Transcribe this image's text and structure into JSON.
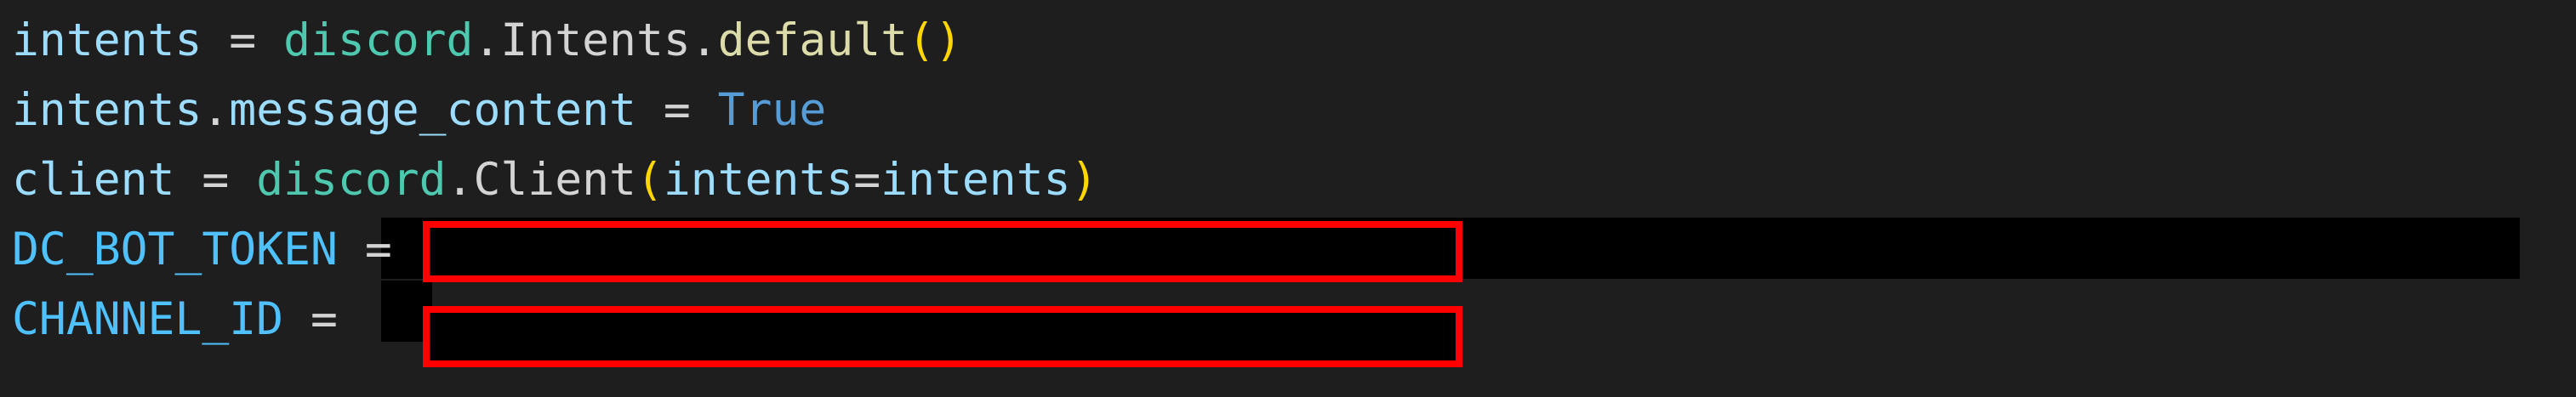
{
  "editor": {
    "lines": [
      {
        "tokens": [
          {
            "text": "intents",
            "kind": "var"
          },
          {
            "text": " = ",
            "kind": "plain"
          },
          {
            "text": "discord",
            "kind": "mod"
          },
          {
            "text": ".",
            "kind": "plain"
          },
          {
            "text": "Intents",
            "kind": "plain"
          },
          {
            "text": ".",
            "kind": "plain"
          },
          {
            "text": "default",
            "kind": "fn"
          },
          {
            "text": "()",
            "kind": "paren"
          }
        ]
      },
      {
        "tokens": [
          {
            "text": "intents",
            "kind": "var"
          },
          {
            "text": ".",
            "kind": "plain"
          },
          {
            "text": "message_content",
            "kind": "var"
          },
          {
            "text": " = ",
            "kind": "plain"
          },
          {
            "text": "True",
            "kind": "kw"
          }
        ]
      },
      {
        "tokens": [
          {
            "text": "client",
            "kind": "var"
          },
          {
            "text": " = ",
            "kind": "plain"
          },
          {
            "text": "discord",
            "kind": "mod"
          },
          {
            "text": ".",
            "kind": "plain"
          },
          {
            "text": "Client",
            "kind": "plain"
          },
          {
            "text": "(",
            "kind": "paren"
          },
          {
            "text": "intents",
            "kind": "var"
          },
          {
            "text": "=",
            "kind": "plain"
          },
          {
            "text": "intents",
            "kind": "var"
          },
          {
            "text": ")",
            "kind": "paren"
          }
        ]
      },
      {
        "tokens": [
          {
            "text": "DC_BOT_TOKEN",
            "kind": "const"
          },
          {
            "text": " = ",
            "kind": "plain"
          }
        ]
      },
      {
        "tokens": [
          {
            "text": "CHANNEL_ID",
            "kind": "const"
          },
          {
            "text": " = ",
            "kind": "plain"
          }
        ]
      }
    ]
  },
  "colors": {
    "background": "#1e1e1e",
    "redaction": "#000000",
    "highlight_border": "#ff0000"
  }
}
